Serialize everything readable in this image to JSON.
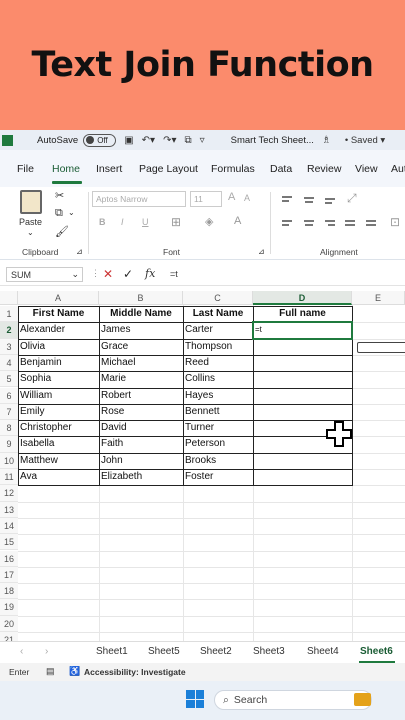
{
  "banner": {
    "title": "Text Join Function"
  },
  "titlebar": {
    "autosave_label": "AutoSave",
    "autosave_state": "Off",
    "doc_title": "Smart Tech Sheet...",
    "saved_label": "• Saved ▾"
  },
  "ribbon_tabs": [
    "File",
    "Home",
    "Insert",
    "Page Layout",
    "Formulas",
    "Data",
    "Review",
    "View",
    "Aut"
  ],
  "ribbon": {
    "paste_label": "Paste",
    "clipboard_label": "Clipboard",
    "font_label": "Font",
    "alignment_label": "Alignment",
    "font_name": "Aptos Narrow",
    "font_size": "11",
    "bold": "B",
    "italic": "I",
    "underline": "U"
  },
  "formula_bar": {
    "name_box": "SUM",
    "content": "=t"
  },
  "columns": [
    "A",
    "B",
    "C",
    "D",
    "E"
  ],
  "row_numbers": [
    "1",
    "2",
    "3",
    "4",
    "5",
    "6",
    "7",
    "8",
    "9",
    "10",
    "11",
    "12",
    "13",
    "14",
    "15",
    "16",
    "17",
    "18",
    "19",
    "20",
    "21"
  ],
  "table": {
    "headers": [
      "First Name",
      "Middle Name",
      "Last Name",
      "Full name"
    ],
    "rows": [
      [
        "Alexander",
        "James",
        "Carter",
        "=t"
      ],
      [
        "Olivia",
        "Grace",
        "Thompson",
        ""
      ],
      [
        "Benjamin",
        "Michael",
        "Reed",
        ""
      ],
      [
        "Sophia",
        "Marie",
        "Collins",
        ""
      ],
      [
        "William",
        "Robert",
        "Hayes",
        ""
      ],
      [
        "Emily",
        "Rose",
        "Bennett",
        ""
      ],
      [
        "Christopher",
        "David",
        "Turner",
        ""
      ],
      [
        "Isabella",
        "Faith",
        "Peterson",
        ""
      ],
      [
        "Matthew",
        "John",
        "Brooks",
        ""
      ],
      [
        "Ava",
        "Elizabeth",
        "Foster",
        ""
      ]
    ]
  },
  "sheets": [
    "Sheet1",
    "Sheet5",
    "Sheet2",
    "Sheet3",
    "Sheet4",
    "Sheet6"
  ],
  "active_sheet": "Sheet6",
  "status": {
    "mode": "Enter",
    "accessibility": "Accessibility: Investigate"
  },
  "taskbar": {
    "search_placeholder": "Search"
  },
  "colors": {
    "banner": "#fb8b6c",
    "excel_green": "#1f7a3e"
  }
}
